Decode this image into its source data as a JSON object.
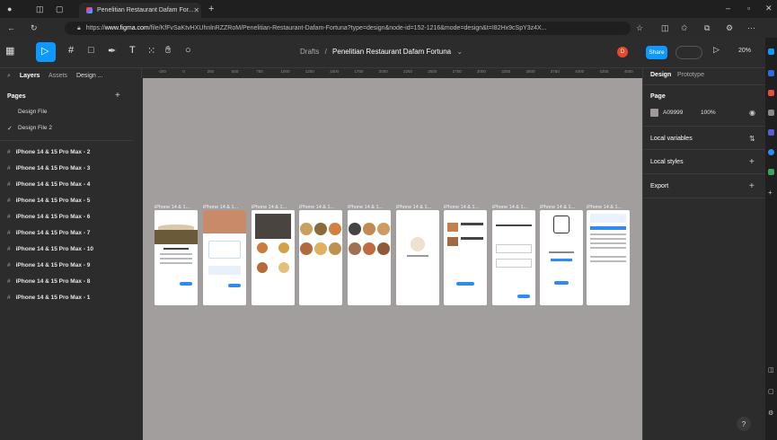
{
  "browser": {
    "tab_title": "Penelitian Restaurant Dafam For...",
    "url_prefix": "https://",
    "url_host": "www.figma.com",
    "url_path": "/file/KfFvSaKtvHXUhnlnRZZRoM/Penelitian-Restaurant-Dafam-Fortuna?type=design&node-id=152-1216&mode=design&t=I82Hx9cSpY3z4X..."
  },
  "toolbar": {
    "breadcrumb_drafts": "Drafts",
    "separator": "/",
    "file_name": "Penelitian Restaurant Dafam Fortuna",
    "avatar_initial": "D",
    "share_label": "Share",
    "zoom_label": "20%"
  },
  "left_panel": {
    "tabs": [
      "Layers",
      "Assets",
      "Design ..."
    ],
    "pages_heading": "Pages",
    "pages": [
      "Design File",
      "Design File 2"
    ],
    "frames": [
      "iPhone 14 & 15 Pro Max - 2",
      "iPhone 14 & 15 Pro Max - 3",
      "iPhone 14 & 15 Pro Max - 4",
      "iPhone 14 & 15 Pro Max - 5",
      "iPhone 14 & 15 Pro Max - 6",
      "iPhone 14 & 15 Pro Max - 7",
      "iPhone 14 & 15 Pro Max - 10",
      "iPhone 14 & 15 Pro Max - 9",
      "iPhone 14 & 15 Pro Max - 8",
      "iPhone 14 & 15 Pro Max - 1"
    ]
  },
  "canvas": {
    "background": "#A09999",
    "ruler_ticks": [
      "-250",
      "0",
      "250",
      "500",
      "750",
      "1000",
      "1250",
      "1500",
      "1750",
      "2000",
      "2250",
      "2500",
      "2750",
      "3000",
      "3250",
      "3500",
      "3750",
      "4000",
      "4250",
      "4500"
    ],
    "frame_labels": [
      "iPhone 14 & 1...",
      "iPhone 14 & 1...",
      "iPhone 14 & 1...",
      "iPhone 14 & 1...",
      "iPhone 14 & 1...",
      "iPhone 14 & 1...",
      "iPhone 14 & 1...",
      "iPhone 14 & 1...",
      "iPhone 14 & 1...",
      "iPhone 14 & 1..."
    ]
  },
  "right_panel": {
    "tabs": [
      "Design",
      "Prototype"
    ],
    "page_heading": "Page",
    "page_color": "A09999",
    "page_opacity": "100%",
    "local_variables": "Local variables",
    "local_styles": "Local styles",
    "export": "Export"
  },
  "help_label": "?"
}
